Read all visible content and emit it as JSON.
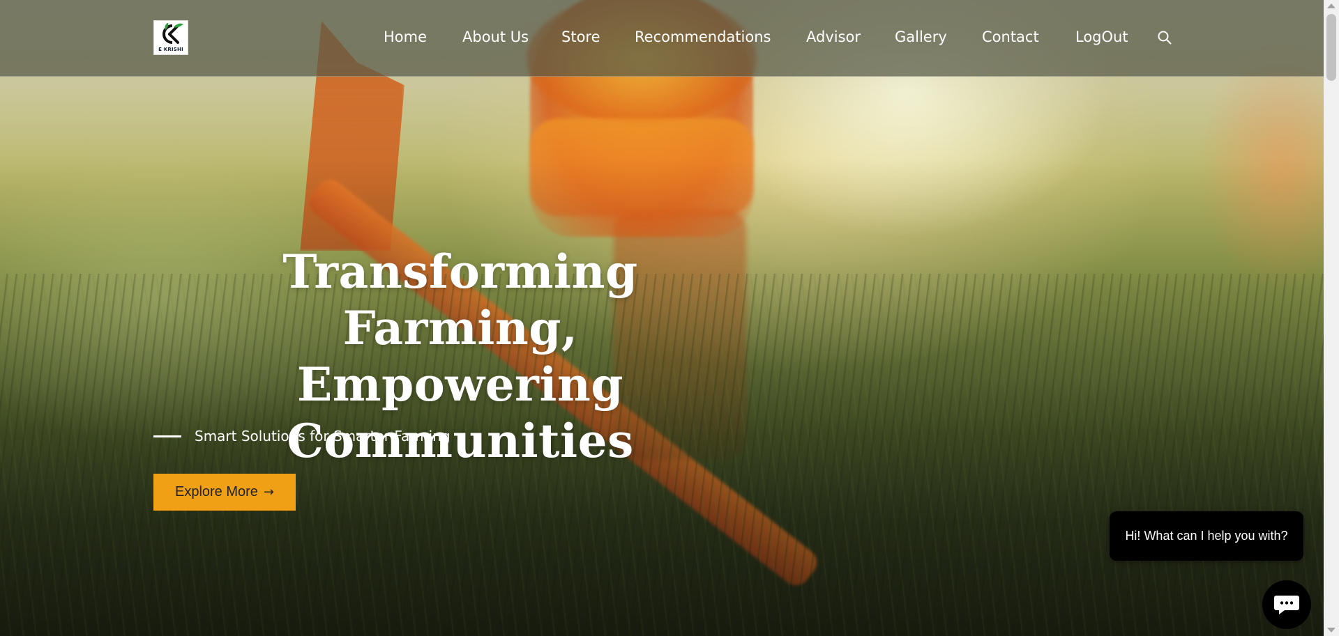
{
  "brand": {
    "logo_text": "E KRISHI"
  },
  "nav": {
    "items": [
      {
        "label": "Home"
      },
      {
        "label": "About Us"
      },
      {
        "label": "Store"
      },
      {
        "label": "Recommendations"
      },
      {
        "label": "Advisor"
      },
      {
        "label": "Gallery"
      },
      {
        "label": "Contact"
      },
      {
        "label": "LogOut"
      }
    ],
    "search_icon": "search-icon"
  },
  "hero": {
    "title_lines": [
      "Transforming Farming,",
      "Empowering",
      "Communities"
    ],
    "tagline": "Smart Solutions for Smarter Farming",
    "cta_label": "Explore More",
    "cta_icon": "arrow-right-icon"
  },
  "chat": {
    "bubble_text": "Hi! What can I help you with?",
    "launcher_icon": "chat-icon"
  },
  "colors": {
    "accent": "#f0a014",
    "nav_overlay": "#585a48",
    "chat_bg": "#000000",
    "text_light": "#ffffff"
  }
}
